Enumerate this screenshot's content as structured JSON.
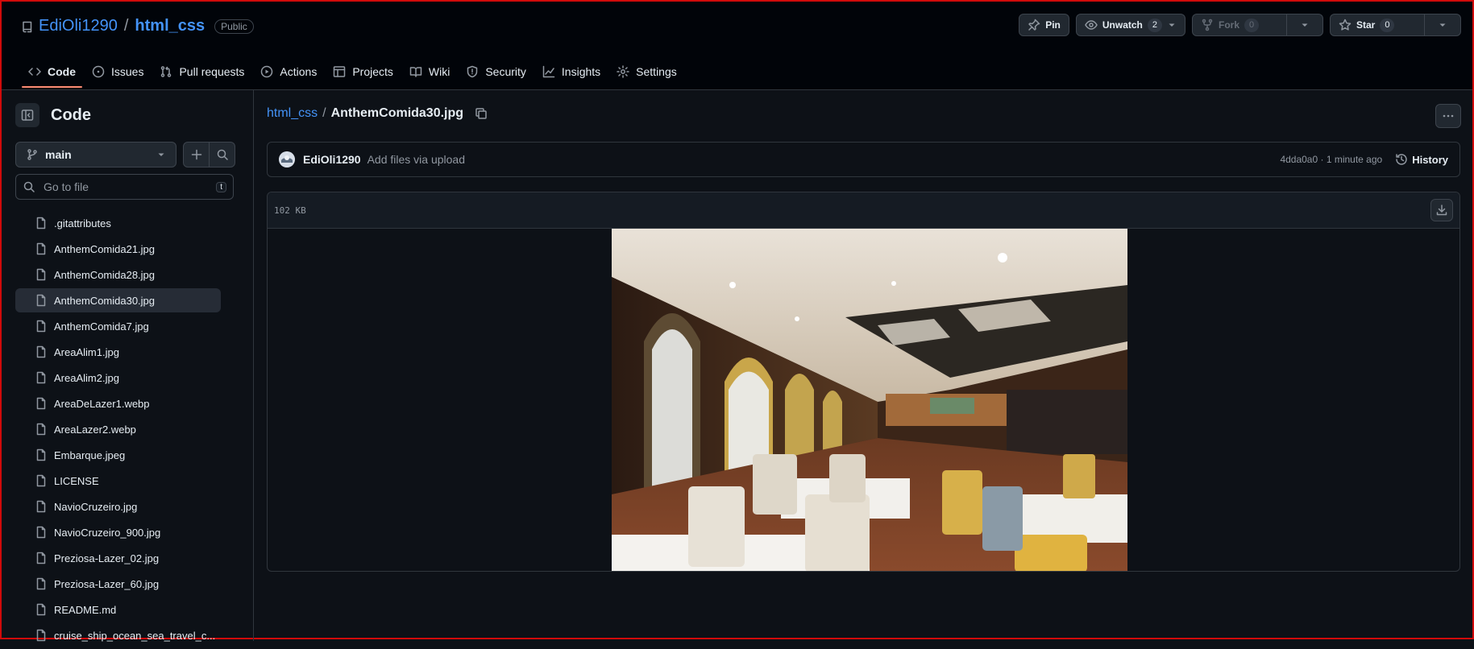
{
  "repo": {
    "owner": "EdiOli1290",
    "separator": "/",
    "name": "html_css",
    "visibility": "Public"
  },
  "header_actions": {
    "pin": "Pin",
    "unwatch": "Unwatch",
    "unwatch_count": "2",
    "fork": "Fork",
    "fork_count": "0",
    "star": "Star",
    "star_count": "0"
  },
  "tabs": [
    {
      "label": "Code",
      "icon": "code-icon",
      "active": true
    },
    {
      "label": "Issues",
      "icon": "issue-icon"
    },
    {
      "label": "Pull requests",
      "icon": "pull-request-icon"
    },
    {
      "label": "Actions",
      "icon": "play-icon"
    },
    {
      "label": "Projects",
      "icon": "table-icon"
    },
    {
      "label": "Wiki",
      "icon": "book-icon"
    },
    {
      "label": "Security",
      "icon": "shield-icon"
    },
    {
      "label": "Insights",
      "icon": "graph-icon"
    },
    {
      "label": "Settings",
      "icon": "gear-icon"
    }
  ],
  "sidebar": {
    "title": "Code",
    "branch": "main",
    "goto_placeholder": "Go to file",
    "goto_shortcut": "t",
    "files": [
      ".gitattributes",
      "AnthemComida21.jpg",
      "AnthemComida28.jpg",
      "AnthemComida30.jpg",
      "AnthemComida7.jpg",
      "AreaAlim1.jpg",
      "AreaAlim2.jpg",
      "AreaDeLazer1.webp",
      "AreaLazer2.webp",
      "Embarque.jpeg",
      "LICENSE",
      "NavioCruzeiro.jpg",
      "NavioCruzeiro_900.jpg",
      "Preziosa-Lazer_02.jpg",
      "Preziosa-Lazer_60.jpg",
      "README.md",
      "cruise_ship_ocean_sea_travel_c..."
    ],
    "selected_file": "AnthemComida30.jpg"
  },
  "breadcrumb": {
    "repo": "html_css",
    "separator": "/",
    "file": "AnthemComida30.jpg"
  },
  "commit": {
    "author": "EdiOli1290",
    "message": "Add files via upload",
    "meta": "4dda0a0 · 1 minute ago",
    "history": "History"
  },
  "file_view": {
    "size": "102 KB"
  },
  "colors": {
    "background": "#0d1117",
    "link": "#4493f8",
    "active_tab_underline": "#fd8c73",
    "border": "#30363d"
  }
}
